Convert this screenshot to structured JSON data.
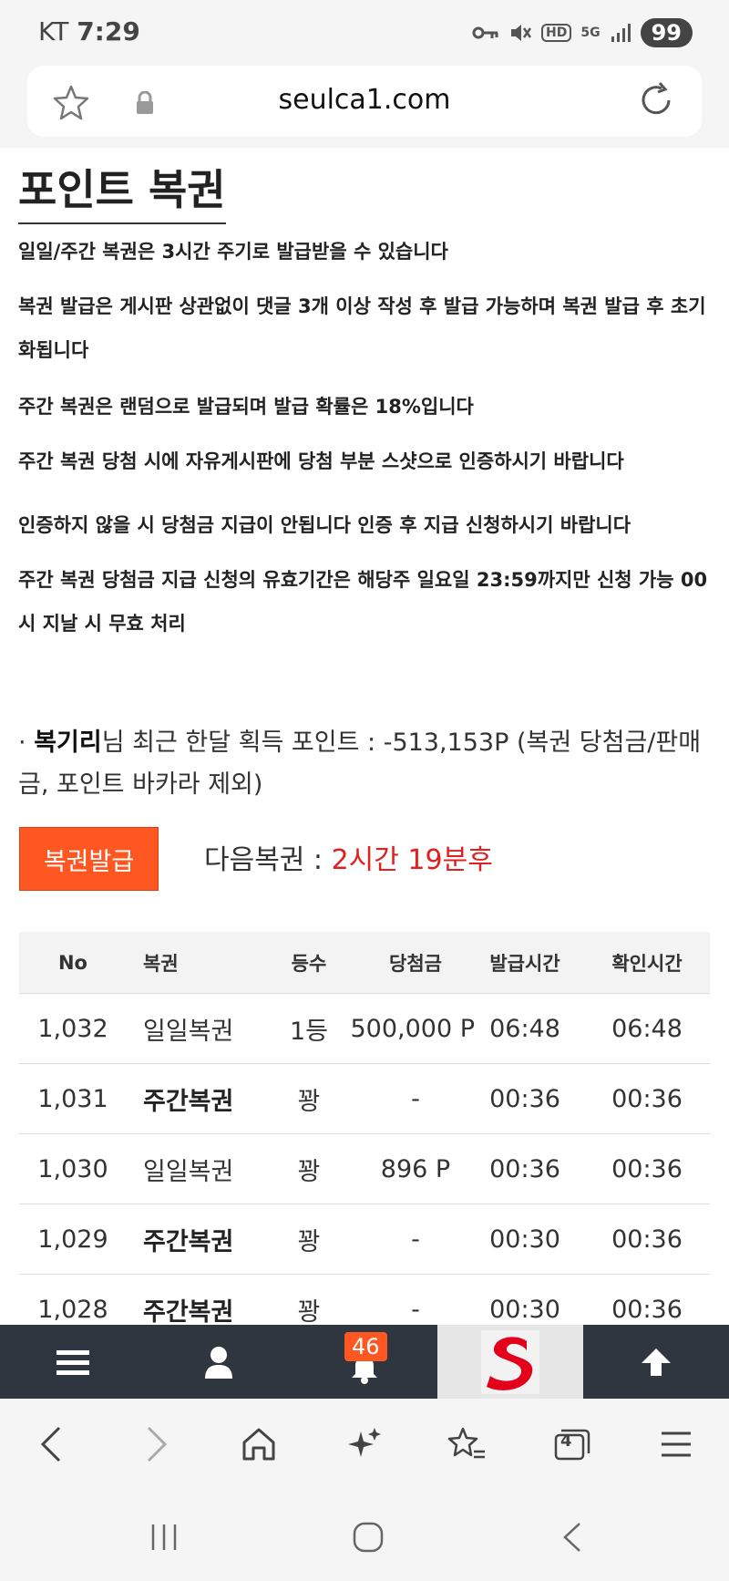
{
  "status_bar": {
    "carrier": "KT",
    "time": "7:29",
    "battery": "99",
    "hd_label": "HD",
    "network_label": "5G"
  },
  "address_bar": {
    "url": "seulca1.com"
  },
  "page": {
    "title": "포인트 복권",
    "notices": [
      "일일/주간 복권은 3시간 주기로 발급받을 수 있습니다",
      "복권 발급은 게시판 상관없이 댓글 3개 이상 작성 후 발급 가능하며 복권 발급 후 초기화됩니다",
      "주간 복권은 랜덤으로 발급되며 발급 확률은 18%입니다",
      "주간 복권 당첨 시에 자유게시판에 당첨 부분 스샷으로 인증하시기 바랍니다",
      "인증하지 않을 시 당첨금 지급이 안됩니다 인증 후 지급 신청하시기 바랍니다",
      "주간 복권 당첨금 지급 신청의 유효기간은 해당주 일요일 23:59까지만 신청 가능 00시 지날 시 무효 처리"
    ],
    "points_bullet": "·",
    "user_name": "복기리",
    "points_text": "님 최근 한달 획득 포인트 : -513,153P (복권 당첨금/판매금, 포인트 바카라 제외)",
    "issue_button": "복권발급",
    "next_label": "다음복권 : ",
    "next_value": "2시간 19분후"
  },
  "table": {
    "headers": [
      "No",
      "복권",
      "등수",
      "당첨금",
      "발급시간",
      "확인시간"
    ],
    "rows": [
      {
        "no": "1,032",
        "lottery": "일일복권",
        "weekly": false,
        "rank": "1등",
        "prize": "500,000 P",
        "issued": "06:48",
        "checked": "06:48"
      },
      {
        "no": "1,031",
        "lottery": "주간복권",
        "weekly": true,
        "rank": "꽝",
        "prize": "-",
        "issued": "00:36",
        "checked": "00:36"
      },
      {
        "no": "1,030",
        "lottery": "일일복권",
        "weekly": false,
        "rank": "꽝",
        "prize": "896 P",
        "issued": "00:36",
        "checked": "00:36"
      },
      {
        "no": "1,029",
        "lottery": "주간복권",
        "weekly": true,
        "rank": "꽝",
        "prize": "-",
        "issued": "00:30",
        "checked": "00:36"
      },
      {
        "no": "1,028",
        "lottery": "주간복권",
        "weekly": true,
        "rank": "꽝",
        "prize": "-",
        "issued": "00:30",
        "checked": "00:36"
      }
    ]
  },
  "site_nav": {
    "notification_count": "46",
    "logo_letter": "S"
  },
  "browser_toolbar": {
    "tab_count": "4"
  },
  "colors": {
    "accent": "#ff5722",
    "next_time": "#e02020",
    "nav_bg": "#2f3640"
  }
}
